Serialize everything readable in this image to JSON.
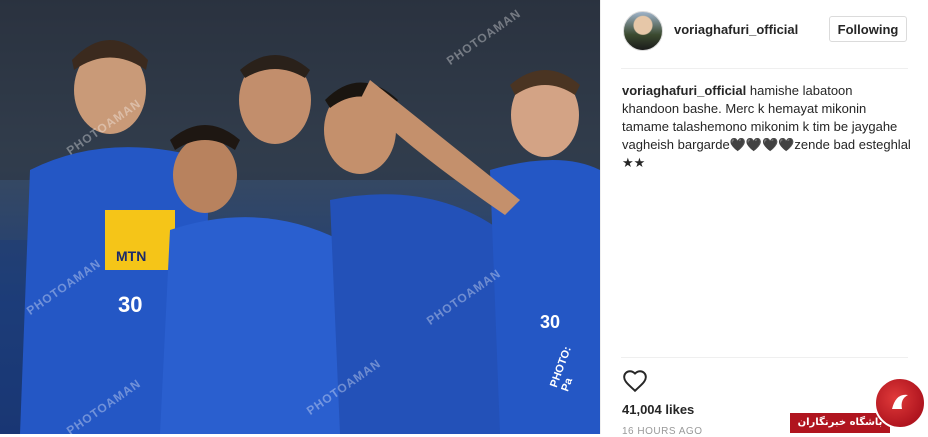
{
  "post": {
    "username": "voriaghafuri_official",
    "follow_label": "Following",
    "caption_username": "voriaghafuri_official",
    "caption_text": "hamishe labatoon khandoon bashe. Merc k hemayat mikonin tamame talashemono mikonim k tim be jaygahe vagheish bargarde🖤🖤🖤🖤zende bad esteghlal ★★",
    "likes": "41,004 likes",
    "timestamp": "16 HOURS AGO"
  },
  "photo": {
    "watermarks": [
      "PHOTOAMAN",
      "PHOTOAMAN",
      "PHOTOAMAN",
      "PHOTOAMAN",
      "PHOTOAMAN",
      "PHOTOAMAN"
    ],
    "shirt_sponsor": "MTN",
    "shirt_number_left": "30",
    "shirt_number_right": "30",
    "photo_credit": "PHOTO: Pa"
  },
  "brand": {
    "label": "باشگاه خبرنگاران"
  },
  "icons": {
    "like": "heart-outline-icon",
    "brand": "newsagency-logo-icon"
  },
  "colors": {
    "jersey_blue": "#2457c5",
    "follow_border": "#dbdbdb",
    "brand_red": "#b0151f"
  }
}
